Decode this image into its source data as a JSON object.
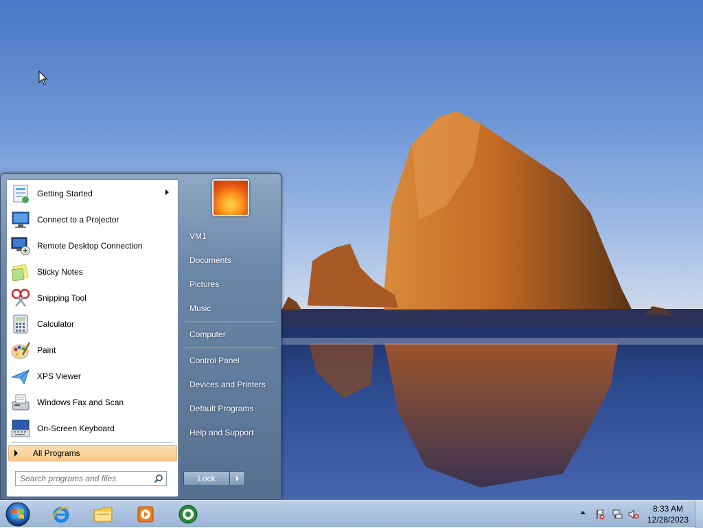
{
  "start_menu": {
    "programs": [
      {
        "label": "Getting Started",
        "icon": "getting-started-icon",
        "has_submenu": true
      },
      {
        "label": "Connect to a Projector",
        "icon": "projector-icon"
      },
      {
        "label": "Remote Desktop Connection",
        "icon": "remote-desktop-icon"
      },
      {
        "label": "Sticky Notes",
        "icon": "sticky-notes-icon"
      },
      {
        "label": "Snipping Tool",
        "icon": "snipping-tool-icon"
      },
      {
        "label": "Calculator",
        "icon": "calculator-icon"
      },
      {
        "label": "Paint",
        "icon": "paint-icon"
      },
      {
        "label": "XPS Viewer",
        "icon": "xps-viewer-icon"
      },
      {
        "label": "Windows Fax and Scan",
        "icon": "fax-scan-icon"
      },
      {
        "label": "On-Screen Keyboard",
        "icon": "keyboard-icon"
      }
    ],
    "all_programs": "All Programs",
    "search_placeholder": "Search programs and files",
    "places": [
      "VM1",
      "Documents",
      "Pictures",
      "Music",
      "Computer",
      "Control Panel",
      "Devices and Printers",
      "Default Programs",
      "Help and Support"
    ],
    "lock_label": "Lock"
  },
  "taskbar": {
    "apps": [
      "internet-explorer-icon",
      "file-explorer-icon",
      "media-player-icon",
      "media-center-icon"
    ],
    "tray_icons": [
      "action-center-flag-icon",
      "network-icon",
      "volume-muted-icon"
    ],
    "clock_time": "8:33 AM",
    "clock_date": "12/28/2023"
  },
  "colors": {
    "all_programs_highlight": "#f9c98a",
    "taskbar": "#a9c1de"
  }
}
